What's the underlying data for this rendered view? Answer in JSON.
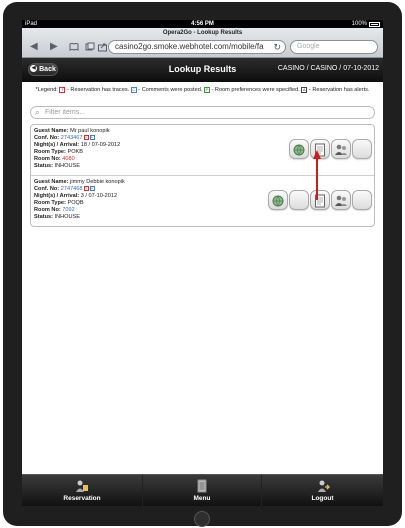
{
  "status_bar": {
    "carrier": "iPad",
    "time": "4:56 PM",
    "battery": "100%"
  },
  "browser": {
    "page_title": "Opera2Go - Lookup Results",
    "url": "casino2go.smoke.webhotel.com/mobile/fa",
    "search_placeholder": "Google"
  },
  "header": {
    "back_label": "Back",
    "title": "Lookup Results",
    "context": "CASINO / CASINO / 07-10-2012"
  },
  "legend": {
    "prefix": "*Legend:",
    "traces_box": "T",
    "traces_text": "- Reservation has traces.",
    "comments_box": "C",
    "comments_text": "- Comments were posted.",
    "prefs_box": "P",
    "prefs_text": "- Room preferences were specified.",
    "alerts_box": "A",
    "alerts_text": "- Reservation has alerts."
  },
  "filter": {
    "placeholder": "Filter items..."
  },
  "labels": {
    "guest_name": "Guest Name:",
    "conf_no": "Conf. No:",
    "nights_arrival": "Night(s) / Arrival:",
    "room_type": "Room Type:",
    "room_no": "Room No:",
    "status": "Status:"
  },
  "results": [
    {
      "guest_name": "Mr paul konopik",
      "conf_no": "2743467",
      "badge_a": "T",
      "badge_b": "C",
      "nights_arrival": "18 / 07-09-2012",
      "room_type": "POKB",
      "room_no": "4080",
      "status": "INHOUSE"
    },
    {
      "guest_name": "jimmy Debbie konopik",
      "conf_no": "2747468",
      "badge_a": "T",
      "badge_b": "C",
      "nights_arrival": "3 / 07-10-2012",
      "room_type": "POQB",
      "room_no": "7092",
      "status": "INHOUSE"
    }
  ],
  "tabbar": {
    "reservation": "Reservation",
    "menu": "Menu",
    "logout": "Logout"
  }
}
